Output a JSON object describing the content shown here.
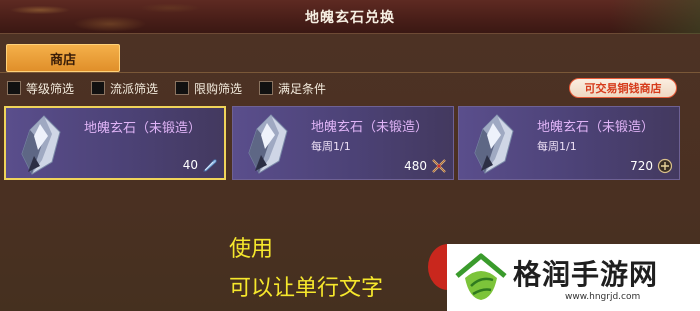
{
  "window": {
    "title": "地魄玄石兑换"
  },
  "tabs": [
    {
      "label": "商店",
      "active": true
    }
  ],
  "filters": [
    {
      "label": "等级筛选",
      "checked": false
    },
    {
      "label": "流派筛选",
      "checked": false
    },
    {
      "label": "限购筛选",
      "checked": false
    },
    {
      "label": "满足条件",
      "checked": false
    }
  ],
  "trade_button": {
    "label": "可交易铜钱商店"
  },
  "items": [
    {
      "name": "地魄玄石（未锻造）",
      "limit": "",
      "price": "40",
      "currency_icon": "feather-quill-icon",
      "selected": true
    },
    {
      "name": "地魄玄石（未锻造）",
      "limit": "每周1/1",
      "price": "480",
      "currency_icon": "crossed-swords-icon",
      "selected": false
    },
    {
      "name": "地魄玄石（未锻造）",
      "limit": "每周1/1",
      "price": "720",
      "currency_icon": "token-coin-icon",
      "selected": false
    }
  ],
  "overlay_caption": {
    "line1": "使用",
    "line2": "可以让单行文字"
  },
  "watermark": {
    "brand": "格润手游网",
    "url": "www.hngrjd.com"
  },
  "colors": {
    "title_bar": "#4a1f19",
    "panel_bg": "#4a3022",
    "tab_active": "#f0a13a",
    "card_bg": "#5a4e8c",
    "card_selected_border": "#f0d45a",
    "item_name": "#e0b4f7",
    "trade_button_text": "#d63b1b",
    "caption_text": "#f6e72c"
  }
}
